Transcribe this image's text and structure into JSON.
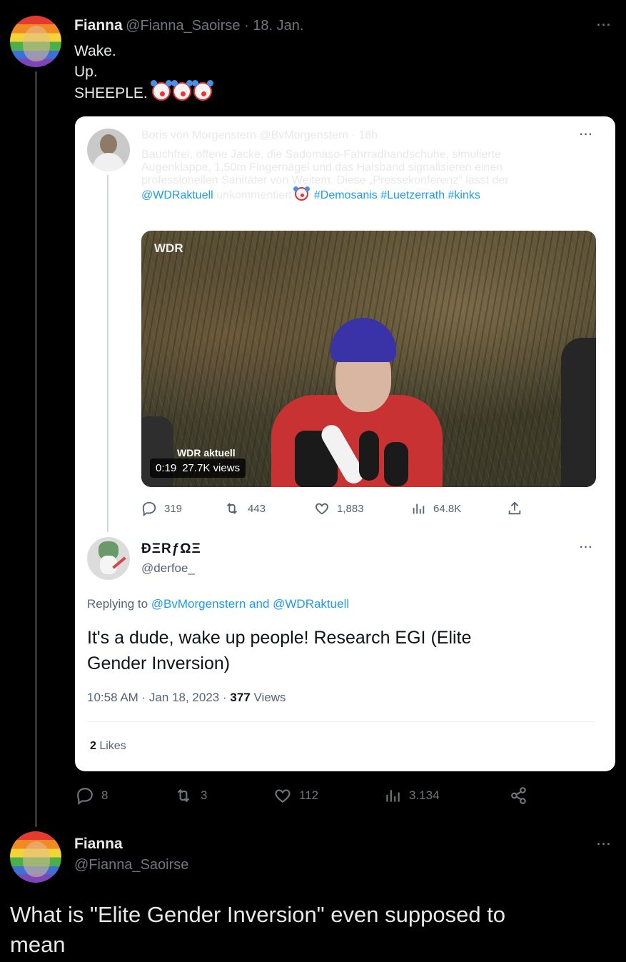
{
  "tweet1": {
    "name": "Fianna",
    "handle_date": "@Fianna_Saoirse · 18. Jan.",
    "lines": [
      "Wake.",
      "Up.",
      "SHEEPLE."
    ],
    "emoji": "clown-emoji",
    "more": "···"
  },
  "quote": {
    "name": "Boris von Morgenstern",
    "handle_time": "@BvMorgenstern · 18h",
    "more": "···",
    "text_lines": [
      "Bauchfrei, offene Jacke, die Sadomaso-Fahrradhandschuhe, simulierte",
      "Augenklappe, 1,50m Fingernägel und das Halsband signalisieren einen",
      "professionellen Sanitäter von Weitem. Diese „Pressekonferenz“ lässt der"
    ],
    "mention": "@WDRaktuell",
    "after_mention": " unkommentiert ",
    "hashtags": "#Demosanis #Luetzerrath #kinks",
    "video": {
      "logo": "WDR",
      "ticker": "WDR aktuell",
      "duration": "0:19",
      "views": "27.7K views"
    },
    "actions": {
      "replies": "319",
      "retweets": "443",
      "likes": "1,883",
      "views": "64.8K"
    }
  },
  "reply": {
    "name": "ÐΞRƒΩΞ",
    "handle": "@derfoe_",
    "more": "···",
    "replying_prefix": "Replying to ",
    "replying_to": "@BvMorgenstern and @WDRaktuell",
    "text_line1": "It's a dude, wake up people! Research EGI (Elite",
    "text_line2": "Gender Inversion)",
    "time": "10:58 AM · Jan 18, 2023 · ",
    "views_count": "377",
    "views_label": " Views",
    "likes_count": "2",
    "likes_label": " Likes"
  },
  "tweet1_actions": {
    "replies": "8",
    "retweets": "3",
    "likes": "112",
    "views": "3.134"
  },
  "tweet2": {
    "name": "Fianna",
    "handle": "@Fianna_Saoirse",
    "more": "···",
    "text_line1": "What is \"Elite Gender Inversion\" even supposed to",
    "text_line2": "mean"
  },
  "colors": {
    "link": "#1d9bf0",
    "background": "#000000",
    "card": "#ffffff"
  }
}
